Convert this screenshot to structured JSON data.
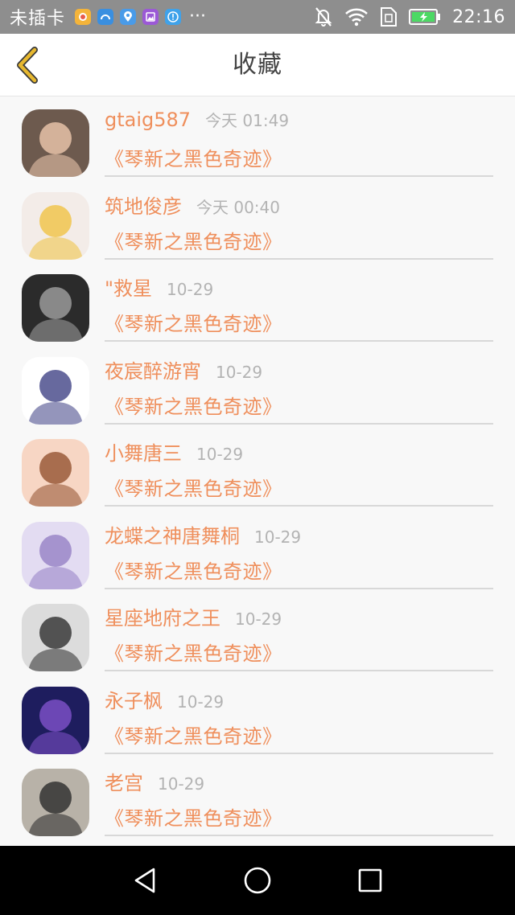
{
  "status_bar": {
    "carrier": "未插卡",
    "dots": "···",
    "time": "22:16",
    "app_icons": [
      {
        "name": "weather-app-icon",
        "color": "#f4b43a"
      },
      {
        "name": "browser-app-icon",
        "color": "#3a8fe0"
      },
      {
        "name": "location-app-icon",
        "color": "#4a9be8"
      },
      {
        "name": "gallery-app-icon",
        "color": "#9b59d6"
      },
      {
        "name": "info-app-icon",
        "color": "#3fa2ea"
      }
    ]
  },
  "header": {
    "title": "收藏",
    "back_icon": "chevron-left-icon",
    "accent": "#e7b82f"
  },
  "items": [
    {
      "username": "gtaig587",
      "time": "今天 01:49",
      "book": "《琴新之黑色奇迹》",
      "avatar_bg": "#6d5a4e",
      "avatar_fg": "#e6c2a8"
    },
    {
      "username": "筑地俊彦",
      "time": "今天 00:40",
      "book": "《琴新之黑色奇迹》",
      "avatar_bg": "#f3ece8",
      "avatar_fg": "#f0c64d"
    },
    {
      "username": "\"救星",
      "time": "10-29",
      "book": "《琴新之黑色奇迹》",
      "avatar_bg": "#2b2b2b",
      "avatar_fg": "#9a9a9a"
    },
    {
      "username": "夜宸醉游宵",
      "time": "10-29",
      "book": "《琴新之黑色奇迹》",
      "avatar_bg": "#ffffff",
      "avatar_fg": "#4c4f8d"
    },
    {
      "username": "小舞唐三",
      "time": "10-29",
      "book": "《琴新之黑色奇迹》",
      "avatar_bg": "#f7d6c4",
      "avatar_fg": "#9a5a3a"
    },
    {
      "username": "龙蝶之神唐舞桐",
      "time": "10-29",
      "book": "《琴新之黑色奇迹》",
      "avatar_bg": "#e3dcf2",
      "avatar_fg": "#9a86c8"
    },
    {
      "username": "星座地府之王",
      "time": "10-29",
      "book": "《琴新之黑色奇迹》",
      "avatar_bg": "#dcdcdc",
      "avatar_fg": "#3a3a3a"
    },
    {
      "username": "永子枫",
      "time": "10-29",
      "book": "《琴新之黑色奇迹》",
      "avatar_bg": "#1e1d5e",
      "avatar_fg": "#7a4fc4"
    },
    {
      "username": "老宫",
      "time": "10-29",
      "book": "《琴新之黑色奇迹》",
      "avatar_bg": "#b8b2a8",
      "avatar_fg": "#333333"
    }
  ],
  "colors": {
    "accent_text": "#ef8f5c",
    "muted_text": "#b3b3b3",
    "status_bar": "#8e8e8e",
    "battery": "#4cd964"
  }
}
